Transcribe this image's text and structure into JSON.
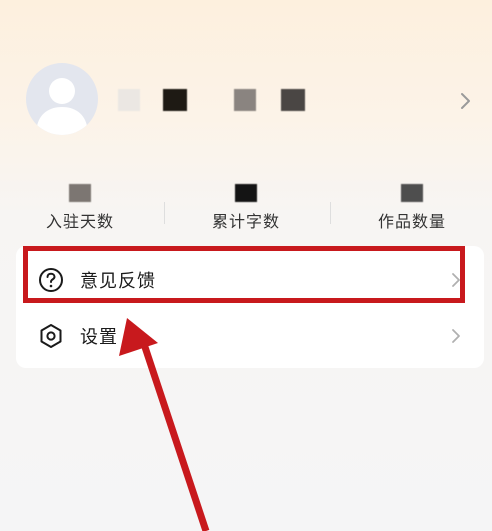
{
  "stats": [
    {
      "label": "入驻天数"
    },
    {
      "label": "累计字数"
    },
    {
      "label": "作品数量"
    }
  ],
  "menu": {
    "feedback": {
      "label": "意见反馈",
      "icon": "question-circle-icon"
    },
    "settings": {
      "label": "设置",
      "icon": "hexagon-settings-icon"
    }
  },
  "colors": {
    "highlight": "#c8191d",
    "arrow": "#c8191d",
    "background_top": "#fdf0de"
  }
}
